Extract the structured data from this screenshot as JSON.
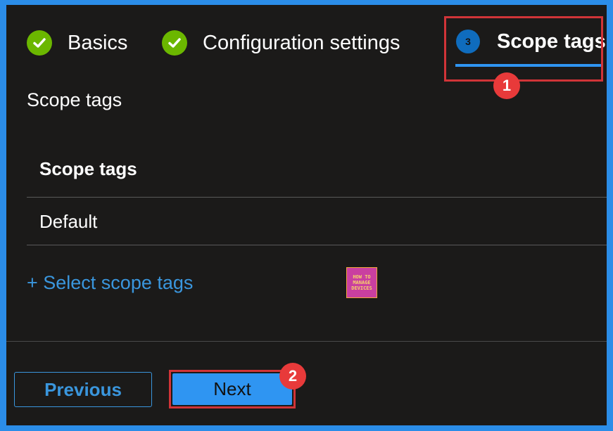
{
  "wizard": {
    "steps": [
      {
        "label": "Basics",
        "state": "completed",
        "icon": "check-icon"
      },
      {
        "label": "Configuration settings",
        "state": "completed",
        "icon": "check-icon"
      },
      {
        "label": "Scope tags",
        "state": "active",
        "number": "3"
      }
    ]
  },
  "section": {
    "heading": "Scope tags",
    "table_header": "Scope tags",
    "rows": [
      "Default"
    ],
    "select_link": "+ Select scope tags"
  },
  "logo": {
    "line1": "HOW TO",
    "line2": "MANAGE",
    "line3": "DEVICES"
  },
  "footer": {
    "previous_label": "Previous",
    "next_label": "Next"
  },
  "annotations": {
    "badge1": "1",
    "badge2": "2"
  },
  "colors": {
    "background": "#1b1a19",
    "accent": "#2f95f2",
    "link": "#3a96dd",
    "success": "#6bb700",
    "annotation_red": "#d13438",
    "frame_blue": "#2b8de8"
  }
}
